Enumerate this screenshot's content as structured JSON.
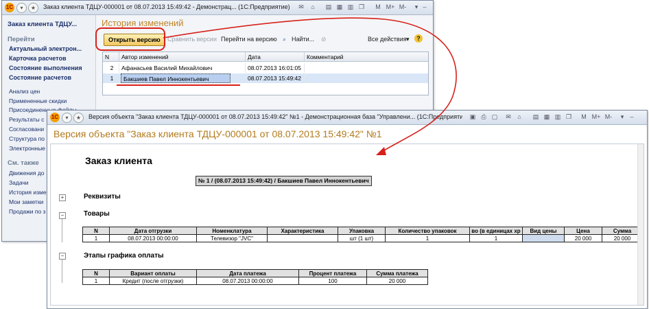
{
  "w1": {
    "title": "Заказ клиента ТДЦУ-000001 от 08.07.2013 15:49:42 - Демонстрац... (1С:Предприятие)",
    "sidebar": {
      "doc_title": "Заказ клиента ТДЦУ...",
      "goto_header": "Перейти",
      "bold_items": [
        "Актуальный электрон...",
        "Карточка расчетов",
        "Состояние выполнения",
        "Состояние расчетов"
      ],
      "links1": [
        "Анализ цен",
        "Примененные скидки",
        "Присоединенные файлы",
        "Результаты с",
        "Согласовани",
        "Структура по",
        "Электронные"
      ],
      "see_also_header": "См. также",
      "links2": [
        "Движения до",
        "Задачи",
        "История измен",
        "Мои заметки",
        "Продажи по з"
      ]
    },
    "section_title": "История изменений",
    "toolbar": {
      "open_version": "Открыть версию",
      "compare_versions": "Сравнить версии",
      "goto_version": "Перейти на версию",
      "find": "Найти...",
      "all_actions": "Все действия",
      "help": "?"
    },
    "grid": {
      "headers": [
        "N",
        "Автор изменений",
        "Дата",
        "Комментарий"
      ],
      "rows": [
        {
          "n": "2",
          "author": "Афанасьев Василий Михайлович",
          "date": "08.07.2013 16:01:05",
          "comment": ""
        },
        {
          "n": "1",
          "author": "Бакшиев Павел Иннокентьевич",
          "date": "08.07.2013 15:49:42",
          "comment": ""
        }
      ]
    }
  },
  "w2": {
    "title": "Версия объекта \"Заказ клиента ТДЦУ-000001 от 08.07.2013 15:49:42\" №1 - Демонстрационная база \"Управлени... (1С:Предприятие)",
    "object_title": "Версия объекта \"Заказ клиента ТДЦУ-000001 от 08.07.2013 15:49:42\" №1",
    "doc": {
      "heading": "Заказ клиента",
      "version_line": "№ 1 / (08.07.2013 15:49:42) / Бакшиев Павел Иннокентьевич",
      "section_requisites": "Реквизиты",
      "section_goods": "Товары",
      "goods_headers": [
        "N",
        "Дата отгрузки",
        "Номенклатура",
        "Характеристика",
        "Упаковка",
        "Количество упаковок",
        "во (в единицах хр",
        "Вид цены",
        "Цена",
        "Сумма"
      ],
      "goods_row": [
        "1",
        "08.07.2013 00:00:00",
        "Телевизор \"JVC\"",
        "",
        "шт (1 шт)",
        "1",
        "1",
        "",
        "20 000",
        "20 000"
      ],
      "section_payments": "Этапы графика оплаты",
      "pay_headers": [
        "N",
        "Вариант оплаты",
        "Дата платежа",
        "Процент платежа",
        "Сумма платежа"
      ],
      "pay_row": [
        "1",
        "Кредит (после отгрузки)",
        "08.07.2013 00:00:00",
        "100",
        "20 000"
      ]
    }
  }
}
